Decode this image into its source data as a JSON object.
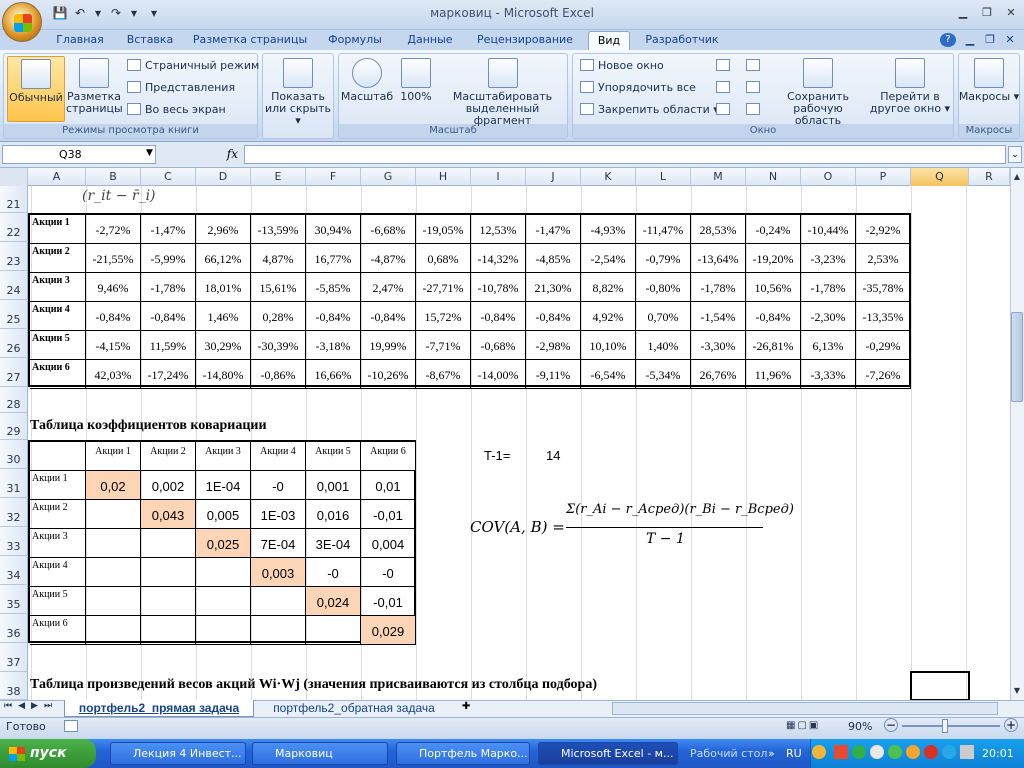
{
  "window": {
    "title": "марковиц - Microsoft Excel"
  },
  "tabs": [
    "Главная",
    "Вставка",
    "Разметка страницы",
    "Формулы",
    "Данные",
    "Рецензирование",
    "Вид",
    "Разработчик"
  ],
  "active_tab": "Вид",
  "ribbon": {
    "views": {
      "normal": "Обычный",
      "page_layout": "Разметка страницы",
      "page_break": "Страничный режим",
      "custom_views": "Представления",
      "full_screen": "Во весь экран",
      "label": "Режимы просмотра книги"
    },
    "show": {
      "label": "Показать или скрыть"
    },
    "zoom": {
      "zoom": "Масштаб",
      "zoom100": "100%",
      "zoom_sel": "Масштабировать выделенный фрагмент",
      "label": "Масштаб"
    },
    "window": {
      "new": "Новое окно",
      "arrange": "Упорядочить все",
      "freeze": "Закрепить области",
      "save_ws": "Сохранить рабочую область",
      "switch": "Перейти в другое окно",
      "label": "Окно"
    },
    "macros": {
      "btn": "Макросы",
      "label": "Макросы"
    }
  },
  "formula_bar": {
    "name_box": "Q38",
    "fx": "fx",
    "formula": ""
  },
  "columns": [
    "A",
    "B",
    "C",
    "D",
    "E",
    "F",
    "G",
    "H",
    "I",
    "J",
    "K",
    "L",
    "M",
    "N",
    "O",
    "P",
    "Q",
    "R"
  ],
  "rows": [
    "21",
    "22",
    "23",
    "24",
    "25",
    "26",
    "27",
    "28",
    "29",
    "30",
    "31",
    "32",
    "33",
    "34",
    "35",
    "36",
    "37",
    "38"
  ],
  "top_formula": "(r_it − r̄_i)",
  "returns_table": {
    "labels": [
      "Акции 1",
      "Акции 2",
      "Акции 3",
      "Акции 4",
      "Акции 5",
      "Акции 6"
    ],
    "values": [
      [
        "-2,72%",
        "-1,47%",
        "2,96%",
        "-13,59%",
        "30,94%",
        "-6,68%",
        "-19,05%",
        "12,53%",
        "-1,47%",
        "-4,93%",
        "-11,47%",
        "28,53%",
        "-0,24%",
        "-10,44%",
        "-2,92%"
      ],
      [
        "-21,55%",
        "-5,99%",
        "66,12%",
        "4,87%",
        "16,77%",
        "-4,87%",
        "0,68%",
        "-14,32%",
        "-4,85%",
        "-2,54%",
        "-0,79%",
        "-13,64%",
        "-19,20%",
        "-3,23%",
        "2,53%"
      ],
      [
        "9,46%",
        "-1,78%",
        "18,01%",
        "15,61%",
        "-5,85%",
        "2,47%",
        "-27,71%",
        "-10,78%",
        "21,30%",
        "8,82%",
        "-0,80%",
        "-1,78%",
        "10,56%",
        "-1,78%",
        "-35,78%"
      ],
      [
        "-0,84%",
        "-0,84%",
        "1,46%",
        "0,28%",
        "-0,84%",
        "-0,84%",
        "15,72%",
        "-0,84%",
        "-0,84%",
        "4,92%",
        "0,70%",
        "-1,54%",
        "-0,84%",
        "-2,30%",
        "-13,35%"
      ],
      [
        "-4,15%",
        "11,59%",
        "30,29%",
        "-30,39%",
        "-3,18%",
        "19,99%",
        "-7,71%",
        "-0,68%",
        "-2,98%",
        "10,10%",
        "1,40%",
        "-3,30%",
        "-26,81%",
        "6,13%",
        "-0,29%"
      ],
      [
        "42,03%",
        "-17,24%",
        "-14,80%",
        "-0,86%",
        "16,66%",
        "-10,26%",
        "-8,67%",
        "-14,00%",
        "-9,11%",
        "-6,54%",
        "-5,34%",
        "26,76%",
        "11,96%",
        "-3,33%",
        "-7,26%"
      ]
    ]
  },
  "cov_title": "Таблица коэффициентов ковариации",
  "cov_table": {
    "headers": [
      "Акции 1",
      "Акции 2",
      "Акции 3",
      "Акции 4",
      "Акции 5",
      "Акции 6"
    ],
    "rows": [
      [
        "0,02",
        "0,002",
        "1E-04",
        "-0",
        "0,001",
        "0,01"
      ],
      [
        "",
        "0,043",
        "0,005",
        "1E-03",
        "0,016",
        "-0,01"
      ],
      [
        "",
        "",
        "0,025",
        "7E-04",
        "3E-04",
        "0,004"
      ],
      [
        "",
        "",
        "",
        "0,003",
        "-0",
        "-0"
      ],
      [
        "",
        "",
        "",
        "",
        "0,024",
        "-0,01"
      ],
      [
        "",
        "",
        "",
        "",
        "",
        "0,029"
      ]
    ]
  },
  "t_label": "T-1=",
  "t_value": "14",
  "formula_lhs": "COV(A, B) =",
  "formula_num": "Σ(r_Ai − r_Aсред)(r_Bi − r_Bсред)",
  "formula_den": "T − 1",
  "bottom_title": "Таблица произведений весов акций Wi·Wj (значения присваиваются из столбца подбора)",
  "sheets": [
    "портфель2_прямая задача",
    "портфель2_обратная задача"
  ],
  "status": {
    "ready": "Готово",
    "zoom": "90%"
  },
  "taskbar": {
    "start": "пуск",
    "tasks": [
      "Лекция 4 Инвест...",
      "Марковиц",
      "Портфель Марко...",
      "Microsoft Excel - м..."
    ],
    "desktop": "Рабочий стол",
    "lang": "RU",
    "clock": "20:01"
  },
  "colors": {
    "peach": "#fbd5b5",
    "accent": "#2465d8"
  }
}
